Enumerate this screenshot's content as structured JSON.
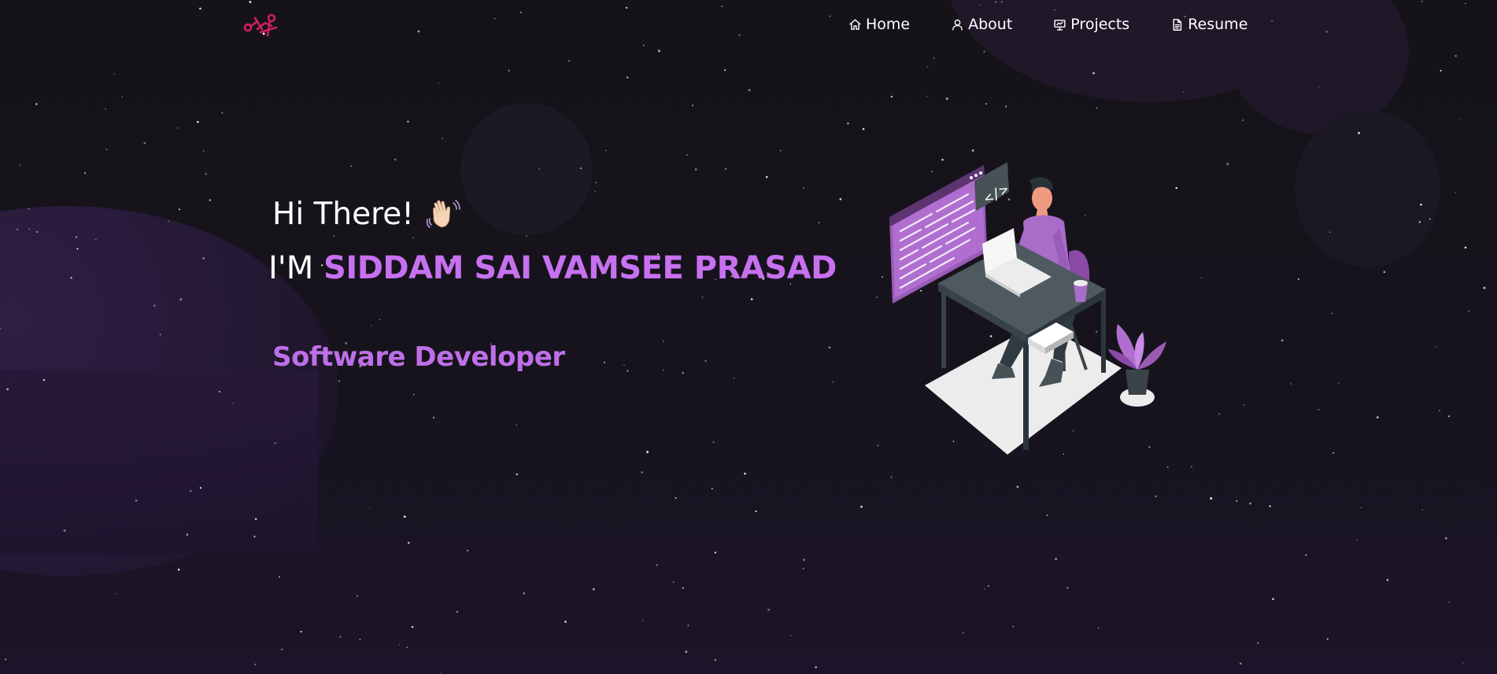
{
  "nav": {
    "logo_icon": "logo-icon",
    "items": [
      {
        "label": "Home",
        "icon": "home-icon"
      },
      {
        "label": "About",
        "icon": "user-icon"
      },
      {
        "label": "Projects",
        "icon": "presentation-icon"
      },
      {
        "label": "Resume",
        "icon": "document-icon"
      }
    ]
  },
  "hero": {
    "greeting": "Hi There!",
    "greeting_emoji": "waving-hand-icon",
    "name_prefix": "I'M",
    "name": "SIDDAM SAI VAMSEE PRASAD",
    "role": "Software Developer",
    "illustration": "developer-at-desk-illustration"
  },
  "colors": {
    "background": "#141216",
    "accent": "#c770f0",
    "logo": "#d11f5c",
    "text": "#ffffff"
  }
}
